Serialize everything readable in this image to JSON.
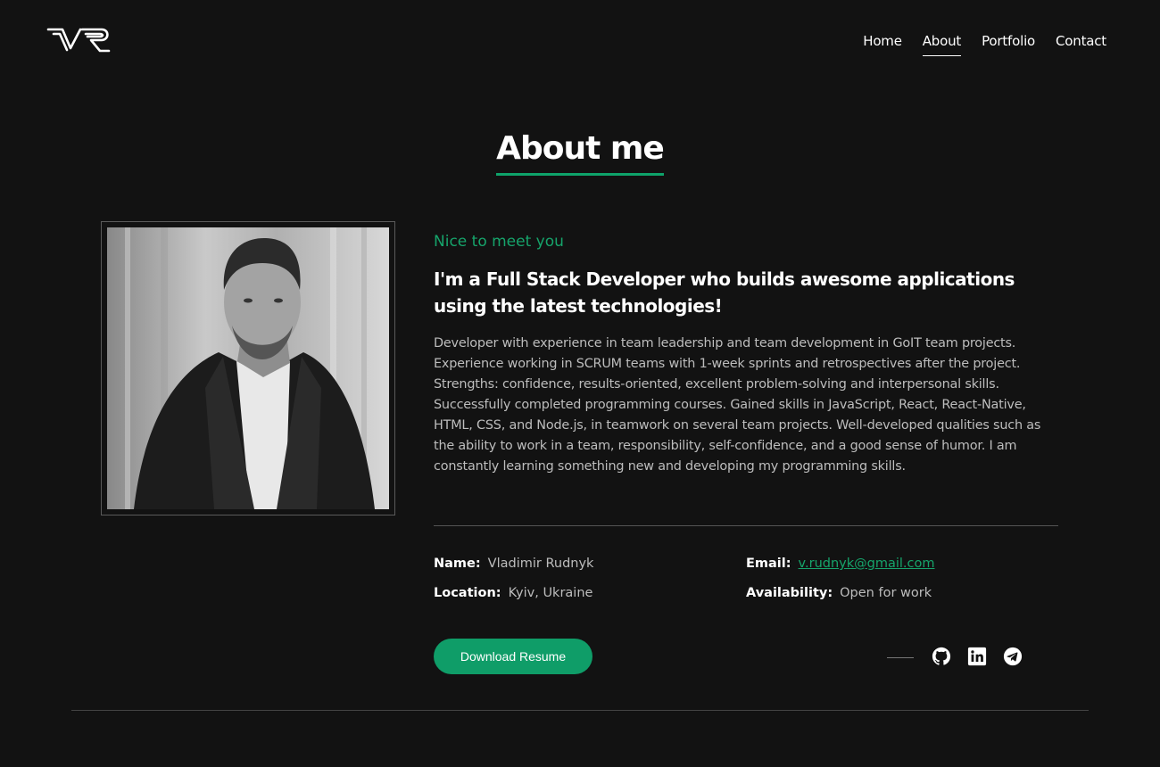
{
  "header": {
    "logo_icon": "vr-logo-icon",
    "nav": [
      {
        "label": "Home",
        "active": false
      },
      {
        "label": "About",
        "active": true
      },
      {
        "label": "Portfolio",
        "active": false
      },
      {
        "label": "Contact",
        "active": false
      }
    ]
  },
  "about": {
    "title": "About me",
    "greeting": "Nice to meet you",
    "headline": "I'm a Full Stack Developer who builds awesome applications using the latest technologies!",
    "bio": "Developer with experience in team leadership and team development in GoIT team projects. Experience working in SCRUM teams with 1-week sprints and retrospectives after the project. Strengths: confidence, results-oriented, excellent problem-solving and interpersonal skills. Successfully completed programming courses. Gained skills in JavaScript, React, React-Native, HTML, CSS, and Node.js, in teamwork on several team projects. Well-developed qualities such as the ability to work in a team, responsibility, self-confidence, and a good sense of humor. I am constantly learning something new and developing my programming skills.",
    "details": {
      "name_label": "Name:",
      "name_value": "Vladimir Rudnyk",
      "location_label": "Location:",
      "location_value": "Kyiv, Ukraine",
      "email_label": "Email:",
      "email_value": "v.rudnyk@gmail.com",
      "availability_label": "Availability:",
      "availability_value": "Open for work"
    },
    "download_label": "Download Resume",
    "social_icons": [
      "github-icon",
      "linkedin-icon",
      "telegram-icon"
    ]
  },
  "colors": {
    "background": "#121212",
    "accent": "#0f9d68",
    "text": "#ffffff",
    "muted": "#bdbdbd"
  }
}
